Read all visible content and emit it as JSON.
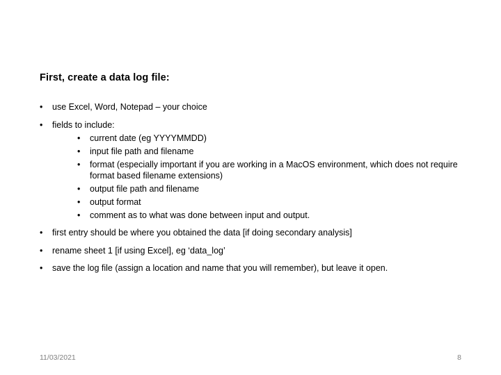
{
  "slide": {
    "title": "First, create a data log file:",
    "bullets": [
      {
        "text": "use Excel, Word, Notepad – your choice"
      },
      {
        "text": "fields to include:",
        "sub": [
          "current date (eg YYYYMMDD)",
          "input file path and filename",
          "format (especially important if you are working in a MacOS environment, which does not require format based filename extensions)",
          "output file path and filename",
          "output format",
          "comment as to what was done between input and output."
        ]
      },
      {
        "text": "first entry should be where you obtained the data [if doing secondary analysis]"
      },
      {
        "text": "rename sheet 1 [if using Excel], eg ‘data_log’"
      },
      {
        "text": "save the log file (assign a location and name that you will remember), but leave it open."
      }
    ]
  },
  "footer": {
    "date": "11/03/2021",
    "page_number": "8"
  }
}
